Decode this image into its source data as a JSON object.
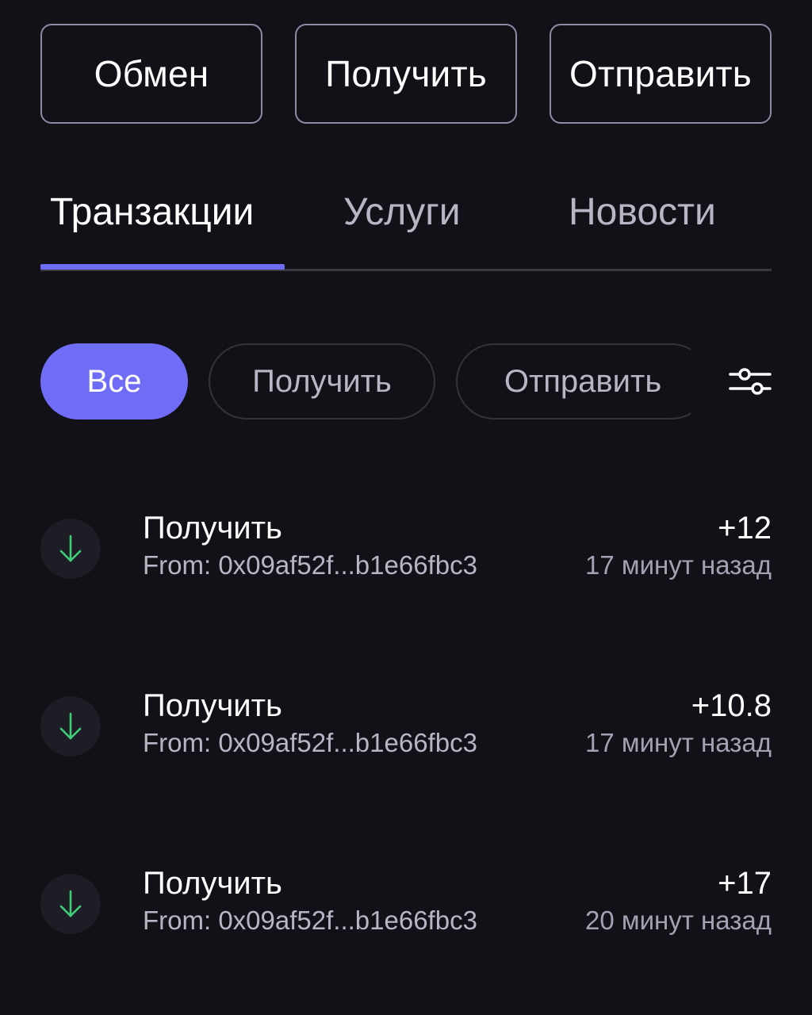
{
  "actions": {
    "swap": "Обмен",
    "receive": "Получить",
    "send": "Отправить"
  },
  "tabs": [
    {
      "label": "Транзакции",
      "active": true
    },
    {
      "label": "Услуги",
      "active": false
    },
    {
      "label": "Новости",
      "active": false
    }
  ],
  "filters": {
    "chips": [
      {
        "label": "Все",
        "selected": true
      },
      {
        "label": "Получить",
        "selected": false
      },
      {
        "label": "Отправить",
        "selected": false
      }
    ],
    "settings_icon": "sliders-icon"
  },
  "transactions": [
    {
      "icon": "arrow-down-icon",
      "title": "Получить",
      "amount": "+12",
      "from": "From: 0x09af52f...b1e66fbc3",
      "time": "17 минут назад"
    },
    {
      "icon": "arrow-down-icon",
      "title": "Получить",
      "amount": "+10.8",
      "from": "From: 0x09af52f...b1e66fbc3",
      "time": "17 минут назад"
    },
    {
      "icon": "arrow-down-icon",
      "title": "Получить",
      "amount": "+17",
      "from": "From: 0x09af52f...b1e66fbc3",
      "time": "20 минут назад"
    }
  ],
  "colors": {
    "background": "#121118",
    "accent": "#6f6cf5",
    "receive_arrow": "#3ecf7a",
    "muted_text": "#b8b6c4"
  }
}
